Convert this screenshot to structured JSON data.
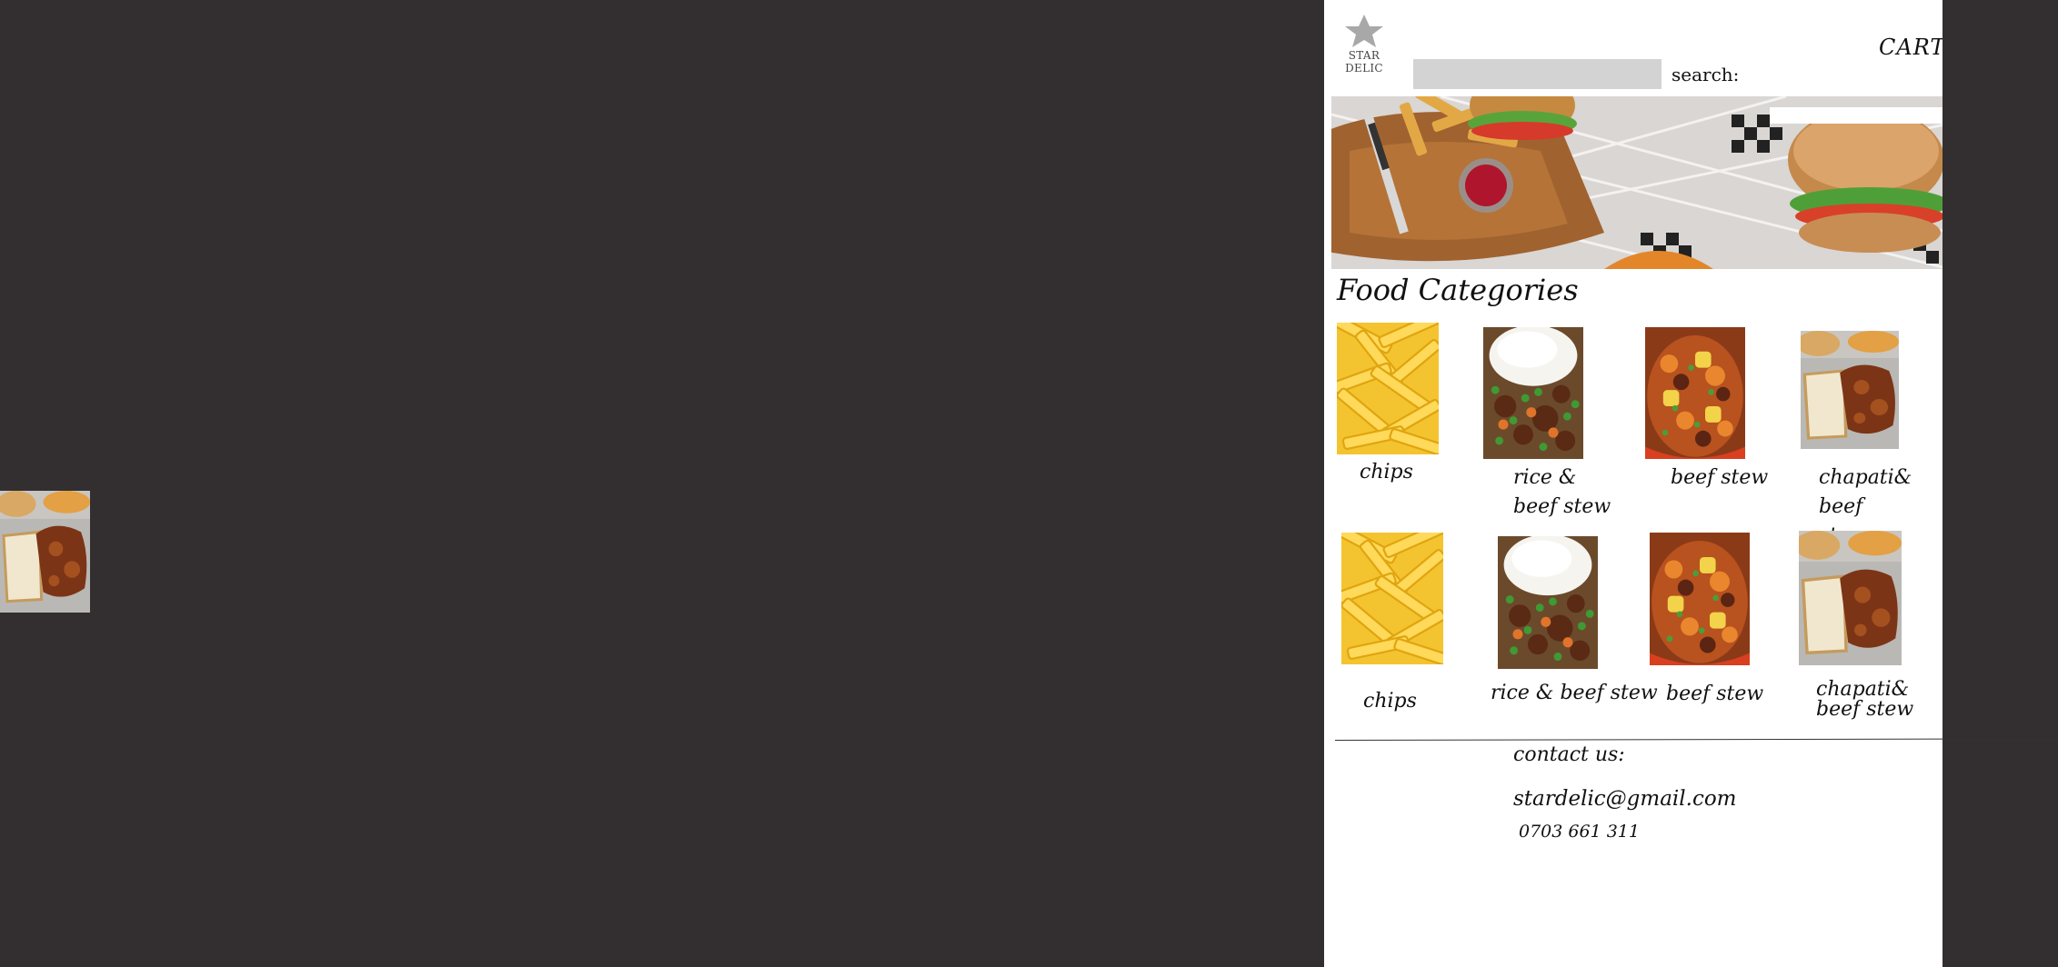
{
  "brand": {
    "name": "STAR DELIC",
    "icon": "star-icon"
  },
  "header": {
    "search_label": "search:",
    "search_value": "",
    "cart_label": "CART"
  },
  "banner": {
    "image": "burger-and-fries-photo"
  },
  "categories": {
    "title": "Food Categories",
    "row1": [
      {
        "label": "chips",
        "image": "chips-photo"
      },
      {
        "label": "rice & beef stew",
        "image": "rice-beef-stew-photo"
      },
      {
        "label": "beef stew",
        "image": "beef-stew-photo"
      },
      {
        "label": "chapati& beef stew",
        "image": "chapati-beef-stew-photo"
      }
    ],
    "row2": [
      {
        "label": "chips",
        "image": "chips-photo"
      },
      {
        "label": "rice & beef stew",
        "image": "rice-beef-stew-photo"
      },
      {
        "label": "beef stew",
        "image": "beef-stew-photo"
      },
      {
        "label": "chapati& beef stew",
        "image": "chapati-beef-stew-photo"
      }
    ]
  },
  "contact": {
    "title": "contact us:",
    "email": "stardelic@gmail.com",
    "phone": "0703  661 311"
  },
  "colors": {
    "background": "#332e2f",
    "page": "#ffffff",
    "search_box": "#d3d3d3"
  }
}
